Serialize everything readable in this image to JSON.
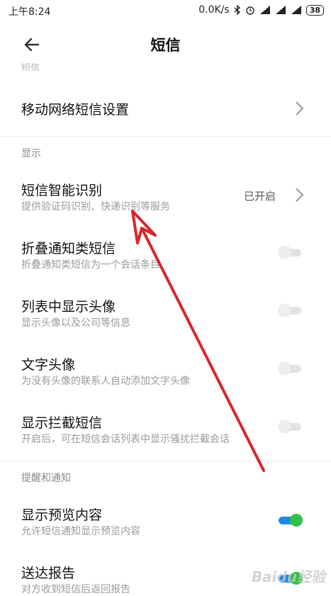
{
  "status_bar": {
    "time": "上午8:24",
    "network_speed": "0.0K/s",
    "battery": "38"
  },
  "app_bar": {
    "title": "短信"
  },
  "faded_section": "短信",
  "rows": {
    "mobile_sms_settings": {
      "title": "移动网络短信设置"
    },
    "smart_recognition": {
      "title": "短信智能识别",
      "subtitle": "提供验证码识别、快递识别等服务",
      "status": "已开启"
    },
    "fold_notifications": {
      "title": "折叠通知类短信",
      "subtitle": "折叠通知类短信为一个会话条目",
      "enabled": false
    },
    "show_avatar": {
      "title": "列表中显示头像",
      "subtitle": "显示头像以及公司等信息",
      "enabled": false
    },
    "text_avatar": {
      "title": "文字头像",
      "subtitle": "为没有头像的联系人自动添加文字头像",
      "enabled": false
    },
    "show_blocked": {
      "title": "显示拦截短信",
      "subtitle": "开启后，可在短信会话列表中显示骚扰拦截会话",
      "enabled": false
    },
    "show_preview": {
      "title": "显示预览内容",
      "subtitle": "允许短信通知显示预览内容",
      "enabled": true
    },
    "delivery_report": {
      "title": "送达报告",
      "subtitle": "对方收到短信后返回报告",
      "enabled": true
    }
  },
  "sections": {
    "display": "显示",
    "reminders": "提醒和通知"
  },
  "watermark": "Baidu经验",
  "colors": {
    "toggle_on_track": "#1e88e5",
    "toggle_on_knob": "#2fc244",
    "annotation_arrow": "#d9262b"
  }
}
